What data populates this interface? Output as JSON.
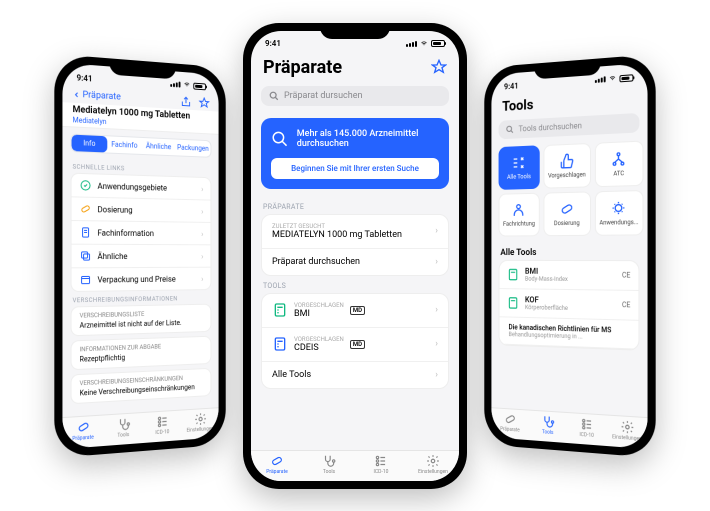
{
  "status": {
    "time": "9:41"
  },
  "tabbar": {
    "items": [
      {
        "label": "Präparate"
      },
      {
        "label": "Tools"
      },
      {
        "label": "ICD-10"
      },
      {
        "label": "Einstellungen"
      }
    ]
  },
  "phone1": {
    "back": "Präparate",
    "title": "Mediatelyn 1000 mg Tabletten",
    "subtitle": "Mediatelyn",
    "tabs": [
      "Info",
      "Fachinfo",
      "Ähnliche",
      "Packungen"
    ],
    "links_header": "SCHNELLE LINKS",
    "links": [
      {
        "label": "Anwendungsgebiete",
        "icon": "target",
        "color": "#10b981"
      },
      {
        "label": "Dosierung",
        "icon": "pill",
        "color": "#f59e0b"
      },
      {
        "label": "Fachinformation",
        "icon": "doc",
        "color": "#2563ff"
      },
      {
        "label": "Ähnliche",
        "icon": "copy",
        "color": "#2563ff"
      },
      {
        "label": "Verpackung und Preise",
        "icon": "box",
        "color": "#2563ff"
      }
    ],
    "section2": "VERSCHREIBUNGSINFORMATIONEN",
    "sub2": "VERSCHREIBUNGSLISTE",
    "text2": "Arzneimittel ist nicht auf der Liste.",
    "sub3": "INFORMATIONEN ZUR ABGABE",
    "text3": "Rezeptpflichtig",
    "sub4": "VERSCHREIBUNGSEINSCHRÄNKUNGEN",
    "text4": "Keine Verschreibungseinschränkungen"
  },
  "phone2": {
    "title": "Präparate",
    "search_placeholder": "Präparat dursuchen",
    "promo_title": "Mehr als 145.000 Arzneimittel durchsuchen",
    "promo_button": "Beginnen Sie mit Ihrer ersten Suche",
    "section_prep": "PRÄPARATE",
    "recent_label": "ZULETZT GESUCHT",
    "recent_value": "MEDIATELYN 1000 mg Tabletten",
    "search_row": "Präparat durchsuchen",
    "section_tools": "TOOLS",
    "suggested": "VORGESCHLAGEN",
    "tool1": "BMI",
    "tool2": "CDEIS",
    "all_tools": "Alle Tools"
  },
  "phone3": {
    "title": "Tools",
    "search_placeholder": "Tools durchsuchen",
    "tiles": [
      {
        "label": "Alle Tools"
      },
      {
        "label": "Vorgeschlagen"
      },
      {
        "label": "ATC"
      },
      {
        "label": "Fachrichtung"
      },
      {
        "label": "Dosierung"
      },
      {
        "label": "Anwendungs..."
      }
    ],
    "all_header": "Alle Tools",
    "tools": [
      {
        "title": "BMI",
        "sub": "Body-Mass-Index",
        "badge": "CE"
      },
      {
        "title": "KOF",
        "sub": "Körperoberfläche",
        "badge": "CE"
      },
      {
        "title": "Die kanadischen Richtlinien für MS",
        "sub": "Behandlungsoptimierung in ...",
        "badge": ""
      }
    ]
  }
}
